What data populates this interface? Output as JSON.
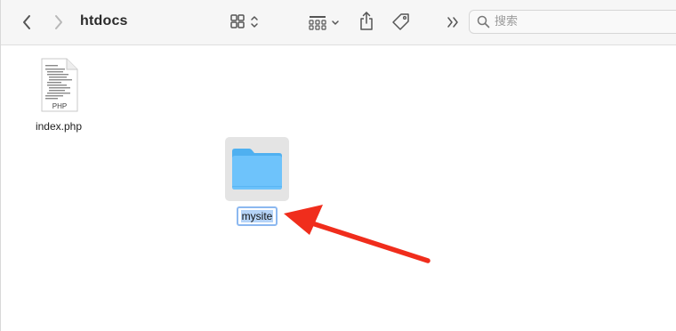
{
  "window": {
    "title": "htdocs"
  },
  "toolbar": {
    "back_icon": "chevron-left-icon",
    "forward_icon": "chevron-right-icon",
    "view_icon": "grid-view-icon",
    "group_icon": "group-by-icon",
    "share_icon": "share-icon",
    "tag_icon": "tag-icon",
    "more_icon": "double-chevron-right-icon"
  },
  "search": {
    "placeholder": "搜索",
    "value": ""
  },
  "files": [
    {
      "name": "index.php",
      "kind": "php-document",
      "badge": "PHP"
    },
    {
      "name": "mysite",
      "kind": "folder",
      "state": "renaming"
    }
  ],
  "colors": {
    "folder": "#6ec3fb",
    "selection": "#b5d3f7",
    "arrow": "#f02d1c"
  }
}
